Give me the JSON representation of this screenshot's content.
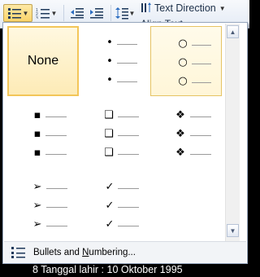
{
  "ribbon": {
    "text_direction_label": "Text Direction",
    "align_text_label": "Align Text"
  },
  "gallery": {
    "none_label": "None",
    "libraries": [
      {
        "name": "none"
      },
      {
        "name": "small-dot",
        "symbol": "•"
      },
      {
        "name": "circle",
        "symbol": "○"
      },
      {
        "name": "square",
        "symbol": "▪"
      },
      {
        "name": "box",
        "symbol": "❑"
      },
      {
        "name": "diamond-cluster",
        "symbol": "❖"
      },
      {
        "name": "arrowhead",
        "symbol": "➢"
      },
      {
        "name": "checkmark",
        "symbol": "✓"
      }
    ]
  },
  "footer": {
    "label_pre": "Bullets and ",
    "label_underlined": "N",
    "label_post": "umbering..."
  },
  "document": {
    "visible_text": "8   Tanggal lahir : 10 Oktober 1995"
  }
}
